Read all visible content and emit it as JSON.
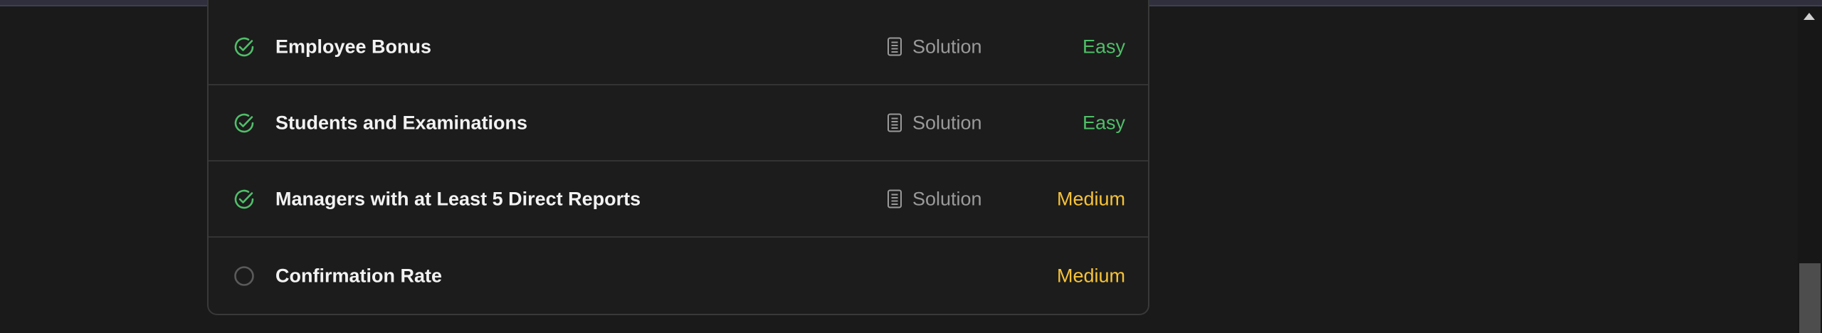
{
  "problems": [
    {
      "title": "Employee Bonus",
      "status": "solved",
      "solution_label": "Solution",
      "difficulty": "Easy",
      "difficulty_color": "#4fbf69"
    },
    {
      "title": "Students and Examinations",
      "status": "solved",
      "solution_label": "Solution",
      "difficulty": "Easy",
      "difficulty_color": "#4fbf69"
    },
    {
      "title": "Managers with at Least 5 Direct Reports",
      "status": "solved",
      "solution_label": "Solution",
      "difficulty": "Medium",
      "difficulty_color": "#f6c239"
    },
    {
      "title": "Confirmation Rate",
      "status": "unsolved",
      "solution_label": "",
      "difficulty": "Medium",
      "difficulty_color": "#f6c239"
    }
  ],
  "icons": {
    "solved": "check-circle-icon",
    "unsolved": "empty-circle-icon",
    "solution": "document-icon"
  },
  "colors": {
    "solved_check": "#4fbf69",
    "unsolved_circle": "#5a5a5a",
    "easy": "#4fbf69",
    "medium": "#f6c239"
  }
}
